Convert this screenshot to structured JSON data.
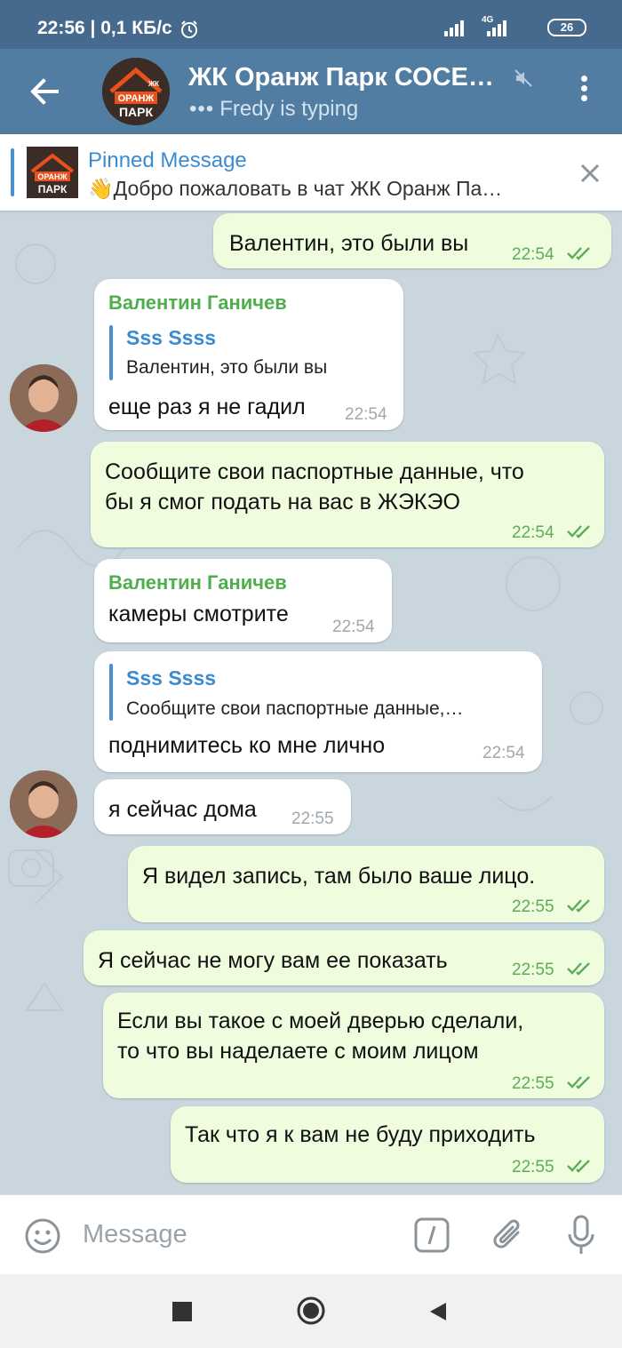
{
  "status_bar": {
    "time": "22:56 | 0,1 КБ/с",
    "battery": "26",
    "network": "4G"
  },
  "header": {
    "title": "ЖК Оранж Парк СОСЕ…",
    "status_dots": "•••",
    "status": "Fredy is typing",
    "avatar_line1": "ОРАНЖ",
    "avatar_line2": "ПАРК",
    "avatar_corner": "ЖК"
  },
  "pinned": {
    "title": "Pinned Message",
    "text": "👋Добро пожаловать в чат ЖК Оранж Па…",
    "thumb_line1": "ОРАНЖ",
    "thumb_line2": "ПАРК"
  },
  "messages": [
    {
      "text": "Валентин, это были вы",
      "time": "22:54"
    },
    {
      "sender": "Валентин Ганичев",
      "reply_name": "Sss Ssss",
      "reply_text": "Валентин, это были вы",
      "text": "еще раз я не гадил",
      "time": "22:54"
    },
    {
      "line1": "Сообщите свои паспортные данные, что",
      "line2": "бы я смог подать на вас в ЖЭКЭО",
      "time": "22:54"
    },
    {
      "sender": "Валентин Ганичев",
      "text": "камеры смотрите",
      "time": "22:54"
    },
    {
      "reply_name": "Sss Ssss",
      "reply_text": "Сообщите свои паспортные данные,…",
      "text": "поднимитесь ко мне лично",
      "time": "22:54"
    },
    {
      "text": "я сейчас дома",
      "time": "22:55"
    },
    {
      "text": "Я видел запись, там было ваше лицо.",
      "time": "22:55"
    },
    {
      "text": "Я сейчас не могу вам ее показать",
      "time": "22:55"
    },
    {
      "line1": "Если вы такое с моей дверью сделали,",
      "line2": "то что вы наделаете с моим лицом",
      "time": "22:55"
    },
    {
      "text": "Так что я к вам не буду приходить",
      "time": "22:55"
    }
  ],
  "input": {
    "placeholder": "Message"
  },
  "colors": {
    "header": "#517da2",
    "status_bar": "#46698e",
    "outgoing": "#effdde",
    "incoming": "#ffffff",
    "sender": "#4fae4e",
    "accent": "#3a8bd0"
  }
}
